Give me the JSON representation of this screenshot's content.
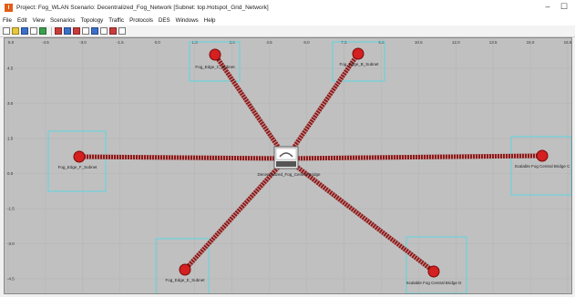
{
  "window": {
    "title": "Project: Fog_WLAN Scenario: Decentralized_Fog_Network  [Subnet: top.Hotspot_Grid_Network]",
    "app_icon_letter": "I",
    "controls": {
      "minimize": "–",
      "maximize": "☐"
    }
  },
  "menu": [
    "File",
    "Edit",
    "View",
    "Scenarios",
    "Topology",
    "Traffic",
    "Protocols",
    "DES",
    "Windows",
    "Help"
  ],
  "toolbar_icons": [
    "open-folder-icon",
    "save-icon",
    "print-icon",
    "palette-icon",
    "object-icon",
    "stop-icon",
    "zoom-in-icon",
    "zoom-out-icon",
    "filter-icon",
    "run-icon",
    "paint-icon",
    "view-icon",
    "config-icon"
  ],
  "canvas": {
    "x_ticks": [
      "5.0",
      "-4.5",
      "-3.0",
      "-1.5",
      "0.0",
      "1.5",
      "3.0",
      "4.5",
      "6.0",
      "7.5",
      "9.0",
      "10.5",
      "12.0",
      "13.5",
      "15.0",
      "16.5"
    ],
    "y_ticks": [
      "4.5",
      "3.0",
      "1.5",
      "0.0",
      "-1.5",
      "-3.0",
      "-4.5"
    ],
    "center_node": {
      "label": "Decentralized_Fog_Central Bridge"
    },
    "nodes": [
      {
        "id": "n-top-left",
        "label": "Fog_Edge_C_Subnet"
      },
      {
        "id": "n-top-right",
        "label": "Fog_Edge_B_Subnet"
      },
      {
        "id": "n-left",
        "label": "Fog_Edge_F_Subnet"
      },
      {
        "id": "n-right",
        "label": "Scalable Fog Central Bridge C"
      },
      {
        "id": "n-bottom-left",
        "label": "Fog_Edge_E_Subnet"
      },
      {
        "id": "n-bottom-right",
        "label": "Scalable Fog Central Bridge D"
      }
    ]
  },
  "colors": {
    "canvas_bg": "#c0c0c0",
    "link": "#8b1a1a",
    "link_dash": "#c9a0a0",
    "node": "#d42020",
    "subnet_box": "#5cd6e0"
  }
}
